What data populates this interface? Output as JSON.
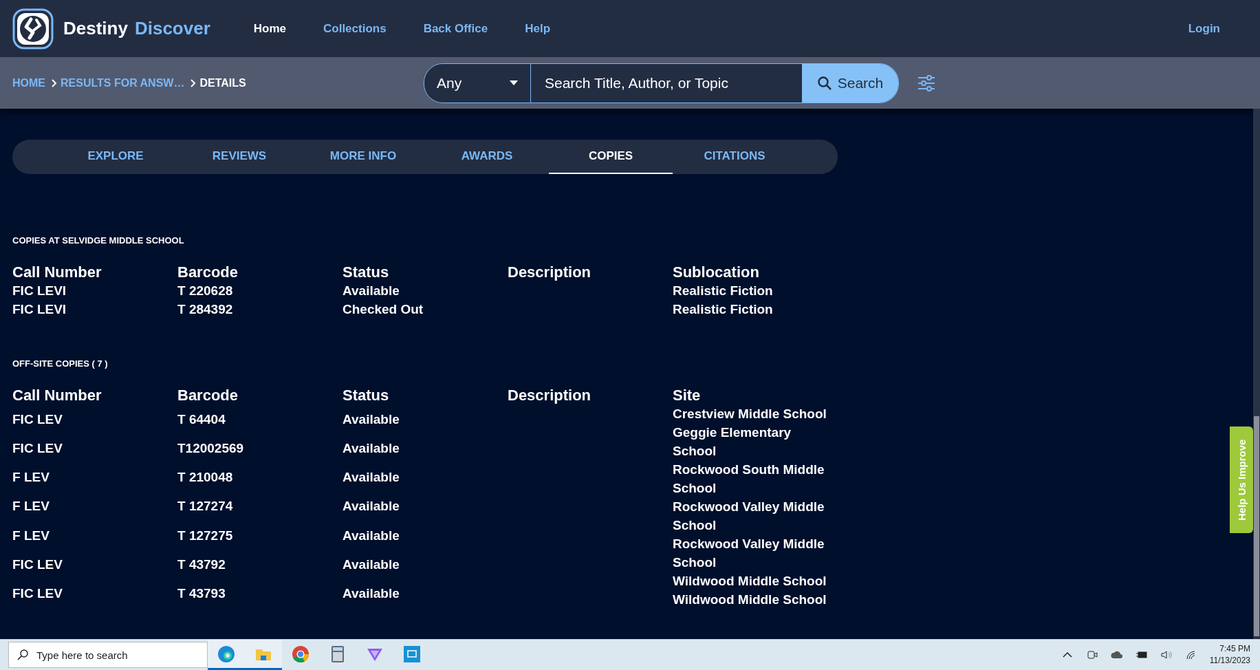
{
  "header": {
    "brand": "Destiny",
    "brand_accent": "Discover",
    "nav": [
      {
        "label": "Home",
        "selected": true
      },
      {
        "label": "Collections",
        "selected": false
      },
      {
        "label": "Back Office",
        "selected": false
      },
      {
        "label": "Help",
        "selected": false
      }
    ],
    "login": "Login"
  },
  "breadcrumb": [
    {
      "label": "HOME",
      "current": false
    },
    {
      "label": "RESULTS FOR ANSW…",
      "current": false
    },
    {
      "label": "DETAILS",
      "current": true
    }
  ],
  "search": {
    "scope": "Any",
    "placeholder": "Search Title, Author, or Topic",
    "button": "Search"
  },
  "tabs": [
    {
      "label": "EXPLORE",
      "selected": false
    },
    {
      "label": "REVIEWS",
      "selected": false
    },
    {
      "label": "MORE INFO",
      "selected": false
    },
    {
      "label": "AWARDS",
      "selected": false
    },
    {
      "label": "COPIES",
      "selected": true
    },
    {
      "label": "CITATIONS",
      "selected": false
    }
  ],
  "local_copies": {
    "title": "COPIES AT SELVIDGE MIDDLE SCHOOL",
    "columns": [
      "Call Number",
      "Barcode",
      "Status",
      "Description",
      "Sublocation"
    ],
    "rows": [
      [
        "FIC LEVI",
        "T 220628",
        "Available",
        "",
        "Realistic Fiction"
      ],
      [
        "FIC LEVI",
        "T 284392",
        "Checked Out",
        "",
        "Realistic Fiction"
      ]
    ]
  },
  "offsite_copies": {
    "title": "OFF-SITE COPIES ( 7 )",
    "columns": [
      "Call Number",
      "Barcode",
      "Status",
      "Description",
      "Site"
    ],
    "rows": [
      [
        "FIC LEV",
        "T 64404",
        "Available"
      ],
      [
        "FIC LEV",
        "T12002569",
        "Available"
      ],
      [
        "F LEV",
        "T 210048",
        "Available"
      ],
      [
        "F LEV",
        "T 127274",
        "Available"
      ],
      [
        "F LEV",
        "T 127275",
        "Available"
      ],
      [
        "FIC LEV",
        "T 43792",
        "Available"
      ],
      [
        "FIC LEV",
        "T 43793",
        "Available"
      ]
    ],
    "sites": [
      "Crestview Middle School",
      "Geggie Elementary School",
      "Rockwood South Middle School",
      "Rockwood Valley Middle School",
      "Rockwood Valley Middle School",
      "Wildwood Middle School",
      "Wildwood Middle School"
    ]
  },
  "feedback_tab": "Help Us Improve",
  "taskbar": {
    "search_placeholder": "Type here to search",
    "apps": [
      {
        "kind": "edge",
        "selected": true
      },
      {
        "kind": "files",
        "selected": true
      },
      {
        "kind": "chrome",
        "selected": false
      },
      {
        "kind": "calculator",
        "selected": false
      },
      {
        "kind": "vpn",
        "selected": false
      },
      {
        "kind": "remote",
        "selected": false
      }
    ],
    "time": "7:45 PM",
    "date": "11/13/2023"
  }
}
